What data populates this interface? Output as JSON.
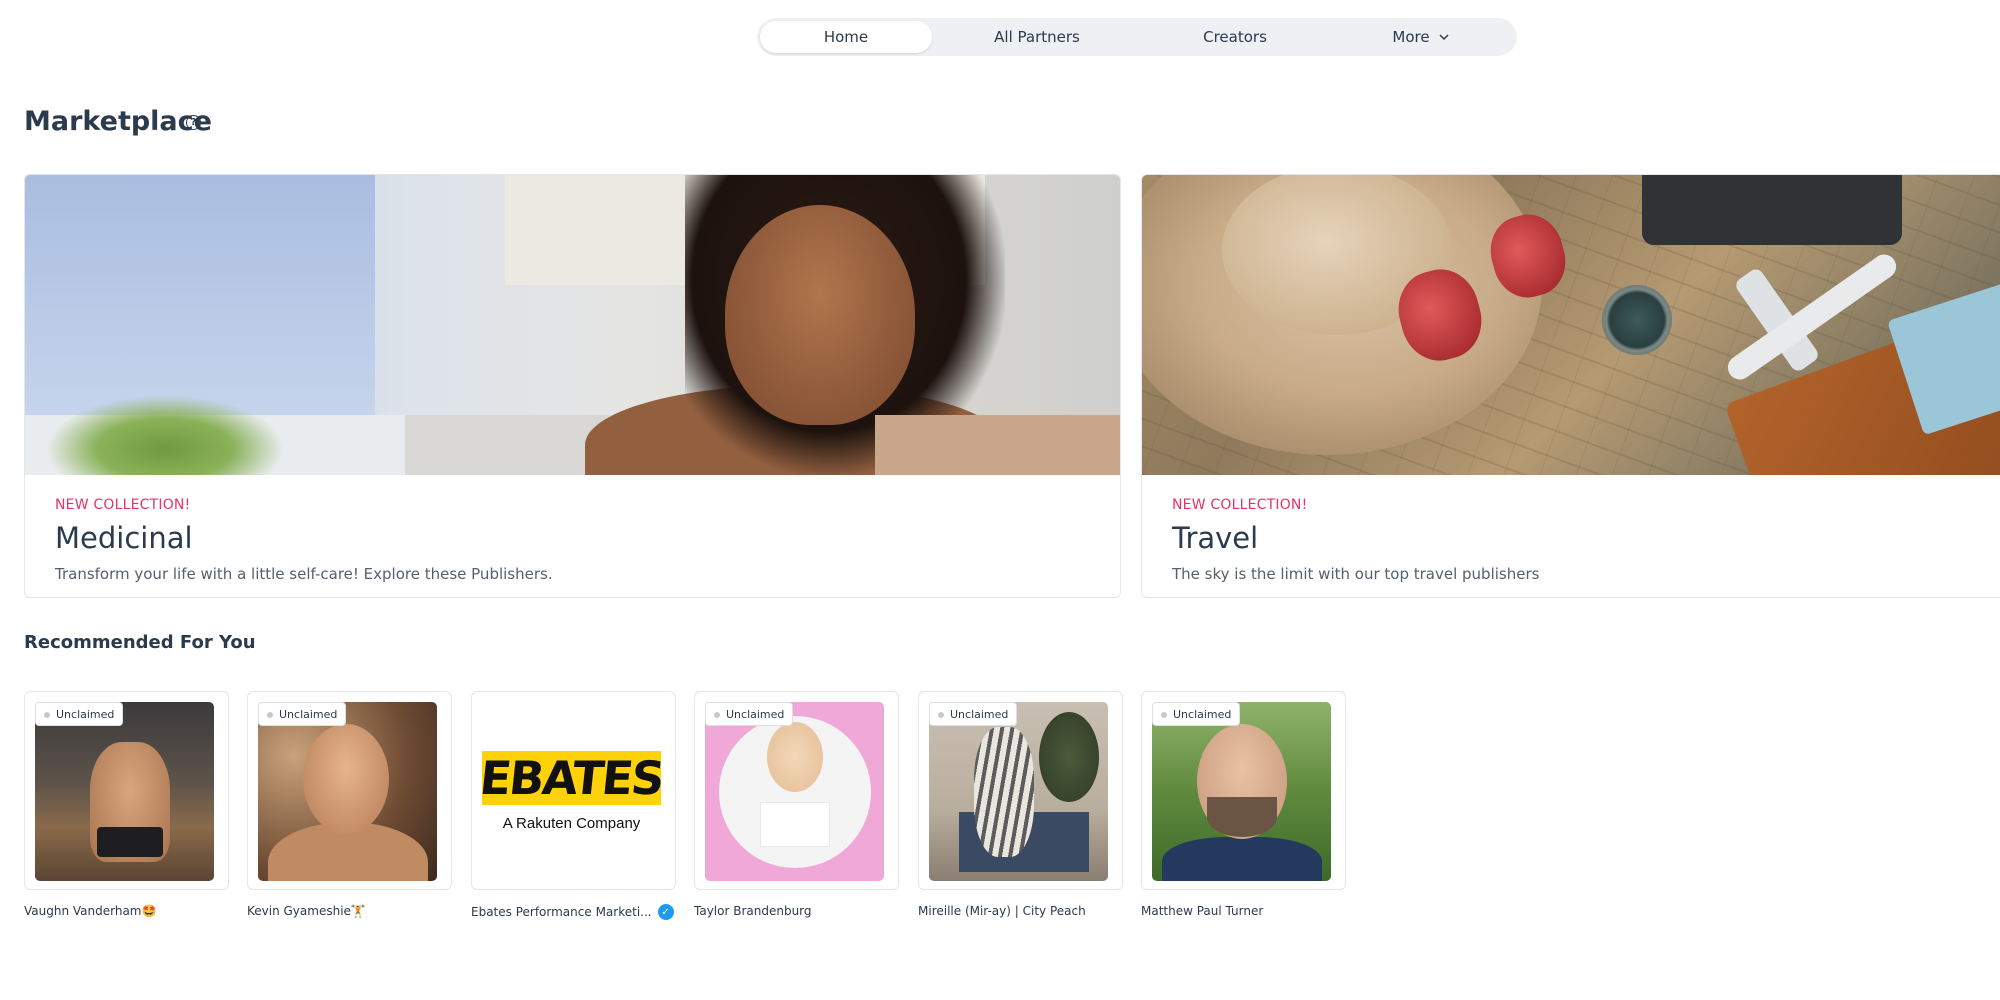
{
  "nav": {
    "home": "Home",
    "all_partners": "All Partners",
    "creators": "Creators",
    "more": "More"
  },
  "page": {
    "title": "Marketplace",
    "help_glyph": "?"
  },
  "collections": [
    {
      "tag": "NEW COLLECTION!",
      "title": "Medicinal",
      "description": "Transform your life with a little self-care! Explore these Publishers."
    },
    {
      "tag": "NEW COLLECTION!",
      "title": "Travel",
      "description": "The sky is the limit with our top travel publishers"
    }
  ],
  "recommended": {
    "title": "Recommended For You",
    "items": [
      {
        "badge": "Unclaimed",
        "name": "Vaughn Vanderham🤩"
      },
      {
        "badge": "Unclaimed",
        "name": "Kevin Gyameshie🏋️"
      },
      {
        "badge": "",
        "name": "Ebates Performance Marketi...",
        "verified": true,
        "logo_main": "EBATES",
        "logo_sub": "A Rakuten Company"
      },
      {
        "badge": "Unclaimed",
        "name": "Taylor Brandenburg"
      },
      {
        "badge": "Unclaimed",
        "name": "Mireille (Mir-ay) | City Peach"
      },
      {
        "badge": "Unclaimed",
        "name": "Matthew Paul Turner"
      }
    ]
  },
  "colors": {
    "accent_tag": "#e8336a",
    "text_primary": "#2c3a4e",
    "verified": "#1d9bf0",
    "nav_bg": "#eef0f3"
  },
  "icons": {
    "help": "question-circle-icon",
    "more": "chevron-down-icon",
    "verified": "verified-check-icon",
    "unclaimed_dot": "status-dot-icon"
  }
}
